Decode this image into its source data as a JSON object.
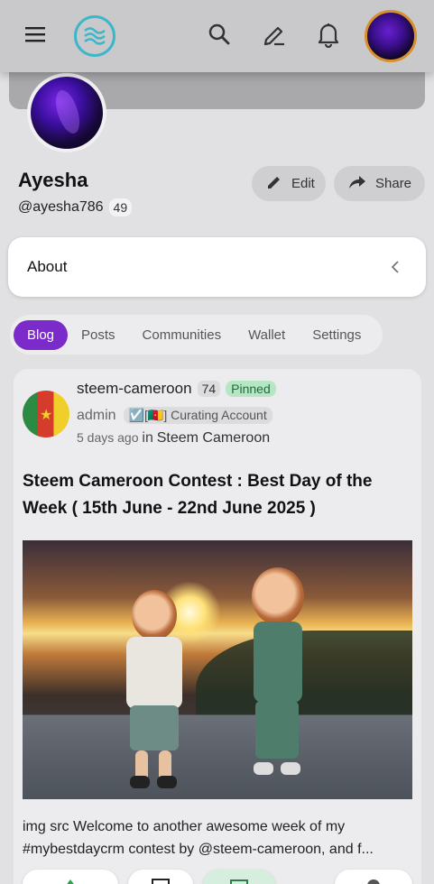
{
  "topbar": {
    "menu_icon": "hamburger-menu-icon",
    "logo_icon": "steem-logo-icon",
    "search_icon": "search-icon",
    "compose_icon": "pen-icon",
    "notifications_icon": "bell-icon",
    "avatar_icon": "user-avatar"
  },
  "profile": {
    "name": "Ayesha",
    "handle": "@ayesha786",
    "reputation": "49",
    "edit_label": "Edit",
    "share_label": "Share"
  },
  "about": {
    "label": "About"
  },
  "tabs": [
    {
      "label": "Blog",
      "active": true
    },
    {
      "label": "Posts",
      "active": false
    },
    {
      "label": "Communities",
      "active": false
    },
    {
      "label": "Wallet",
      "active": false
    },
    {
      "label": "Settings",
      "active": false
    }
  ],
  "post": {
    "author": "steem-cameroon",
    "author_rep": "74",
    "pinned_label": "Pinned",
    "role": "admin",
    "role_tag": "☑️[🇨🇲] Curating Account",
    "time": "5 days ago",
    "in_label": "in",
    "community": "Steem Cameroon",
    "title": "Steem Cameroon Contest : Best Day of the Week ( 15th June - 22nd June 2025 )",
    "excerpt_line1": "img src Welcome to another awesome week of my",
    "excerpt_line2": "#mybestdaycrm contest by @steem-cameroon, and f..."
  },
  "colors": {
    "accent": "#7b2bc9",
    "pinned_bg": "#b7e6c4",
    "logo": "#3cb7c9",
    "avatar_ring": "#d8902a"
  }
}
